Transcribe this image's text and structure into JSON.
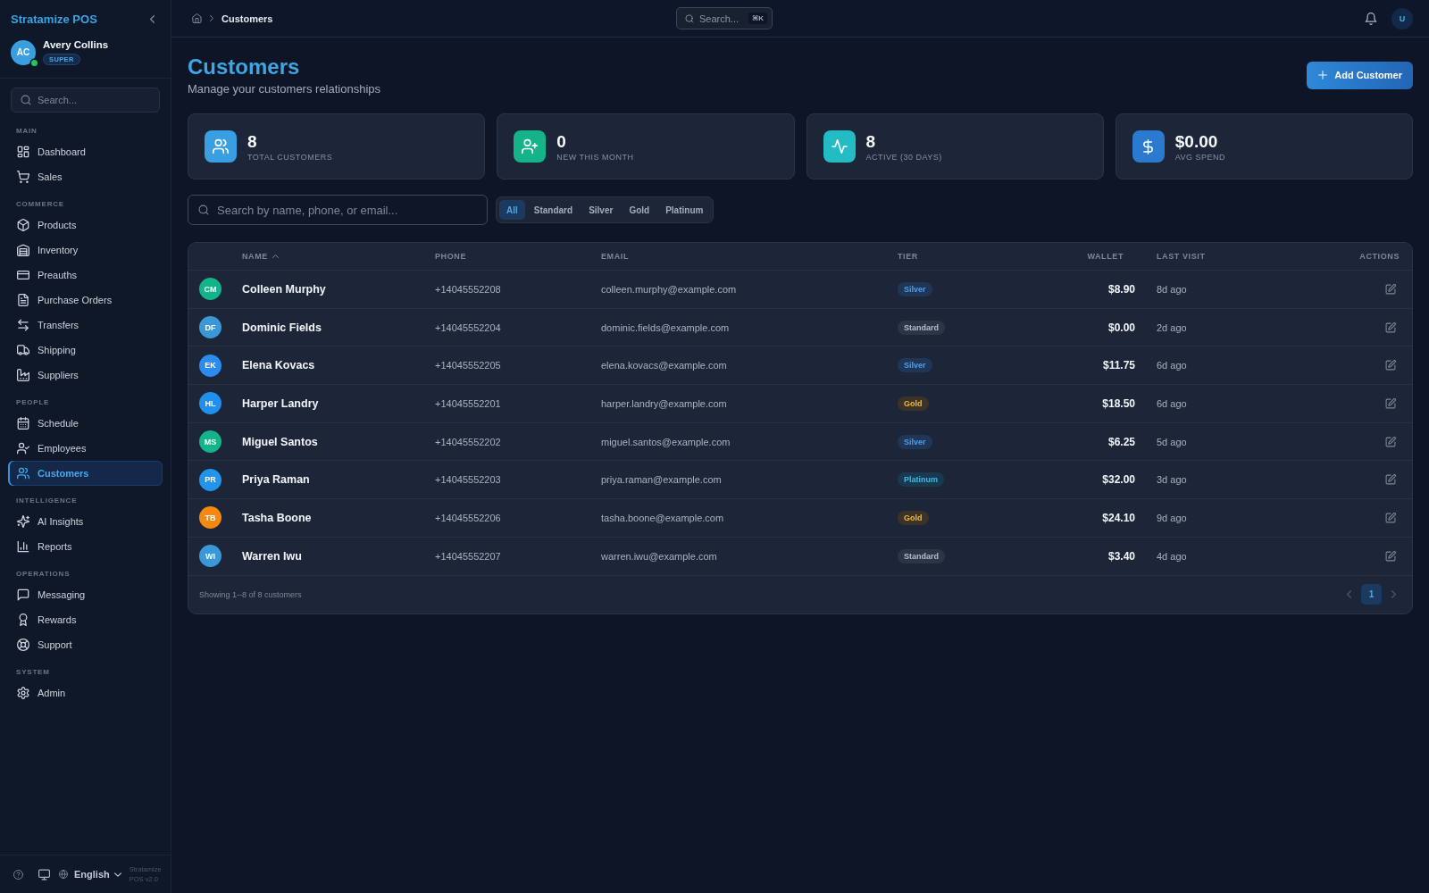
{
  "sidebar": {
    "brand": "Stratamize POS",
    "user": {
      "initials": "AC",
      "name": "Avery Collins",
      "role": "SUPER",
      "online": true
    },
    "search": {
      "placeholder": "Search..."
    },
    "sections": [
      {
        "title": "MAIN",
        "items": [
          {
            "label": "Dashboard",
            "selected": false
          },
          {
            "label": "Sales",
            "selected": false
          }
        ]
      },
      {
        "title": "COMMERCE",
        "items": [
          {
            "label": "Products",
            "selected": false
          },
          {
            "label": "Inventory",
            "selected": false
          },
          {
            "label": "Preauths",
            "selected": false
          },
          {
            "label": "Purchase Orders",
            "selected": false
          },
          {
            "label": "Transfers",
            "selected": false
          },
          {
            "label": "Shipping",
            "selected": false
          },
          {
            "label": "Suppliers",
            "selected": false
          }
        ]
      },
      {
        "title": "PEOPLE",
        "items": [
          {
            "label": "Schedule",
            "selected": false
          },
          {
            "label": "Employees",
            "selected": false
          },
          {
            "label": "Customers",
            "selected": true
          }
        ]
      },
      {
        "title": "INTELLIGENCE",
        "items": [
          {
            "label": "AI Insights",
            "selected": false
          },
          {
            "label": "Reports",
            "selected": false
          }
        ]
      },
      {
        "title": "OPERATIONS",
        "items": [
          {
            "label": "Messaging",
            "selected": false
          },
          {
            "label": "Rewards",
            "selected": false
          },
          {
            "label": "Support",
            "selected": false
          }
        ]
      },
      {
        "title": "SYSTEM",
        "items": [
          {
            "label": "Admin",
            "selected": false
          }
        ]
      }
    ],
    "footer": {
      "language": "English",
      "version": "Stratamize POS v2.0"
    }
  },
  "topbar": {
    "breadcrumb": [
      "Customers"
    ],
    "search": {
      "label": "Search...",
      "shortcut": "⌘K"
    },
    "user_initials": "U"
  },
  "header": {
    "title": "Customers",
    "subtitle": "Manage your customers relationships",
    "add_button": "Add Customer"
  },
  "stats": [
    {
      "value": "8",
      "label": "TOTAL CUSTOMERS",
      "color": "#3a9fe2"
    },
    {
      "value": "0",
      "label": "NEW THIS MONTH",
      "color": "#14b38a"
    },
    {
      "value": "8",
      "label": "ACTIVE (30 DAYS)",
      "color": "#24bcc4"
    },
    {
      "value": "$0.00",
      "label": "AVG SPEND",
      "color": "#2b7ad0"
    }
  ],
  "filters": {
    "search_placeholder": "Search by name, phone, or email...",
    "tiers": [
      {
        "label": "All",
        "selected": true
      },
      {
        "label": "Standard",
        "selected": false
      },
      {
        "label": "Silver",
        "selected": false
      },
      {
        "label": "Gold",
        "selected": false
      },
      {
        "label": "Platinum",
        "selected": false
      }
    ]
  },
  "table": {
    "columns": [
      {
        "label": "NAME",
        "sorted": true
      },
      {
        "label": "PHONE",
        "sorted": false
      },
      {
        "label": "EMAIL",
        "sorted": false
      },
      {
        "label": "TIER",
        "sorted": false
      },
      {
        "label": "WALLET",
        "sorted": false
      },
      {
        "label": "LAST VISIT",
        "sorted": false
      },
      {
        "label": "ACTIONS",
        "sorted": false
      }
    ],
    "rows": [
      {
        "avatar": {
          "initials": "CM",
          "color": "#14b38a"
        },
        "name": "Colleen Murphy",
        "phone": "+14045552208",
        "email": "colleen.murphy@example.com",
        "tier": {
          "label": "Silver",
          "kind": "silver"
        },
        "wallet": "$8.90",
        "last_visit": "8d ago"
      },
      {
        "avatar": {
          "initials": "DF",
          "color": "#3a98d8"
        },
        "name": "Dominic Fields",
        "phone": "+14045552204",
        "email": "dominic.fields@example.com",
        "tier": {
          "label": "Standard",
          "kind": "standard"
        },
        "wallet": "$0.00",
        "last_visit": "2d ago"
      },
      {
        "avatar": {
          "initials": "EK",
          "color": "#2b8cef"
        },
        "name": "Elena Kovacs",
        "phone": "+14045552205",
        "email": "elena.kovacs@example.com",
        "tier": {
          "label": "Silver",
          "kind": "silver"
        },
        "wallet": "$11.75",
        "last_visit": "6d ago"
      },
      {
        "avatar": {
          "initials": "HL",
          "color": "#2090ee"
        },
        "name": "Harper Landry",
        "phone": "+14045552201",
        "email": "harper.landry@example.com",
        "tier": {
          "label": "Gold",
          "kind": "gold"
        },
        "wallet": "$18.50",
        "last_visit": "6d ago"
      },
      {
        "avatar": {
          "initials": "MS",
          "color": "#14b38a"
        },
        "name": "Miguel Santos",
        "phone": "+14045552202",
        "email": "miguel.santos@example.com",
        "tier": {
          "label": "Silver",
          "kind": "silver"
        },
        "wallet": "$6.25",
        "last_visit": "5d ago"
      },
      {
        "avatar": {
          "initials": "PR",
          "color": "#2394ec"
        },
        "name": "Priya Raman",
        "phone": "+14045552203",
        "email": "priya.raman@example.com",
        "tier": {
          "label": "Platinum",
          "kind": "platinum"
        },
        "wallet": "$32.00",
        "last_visit": "3d ago"
      },
      {
        "avatar": {
          "initials": "TB",
          "color": "#f5890f"
        },
        "name": "Tasha Boone",
        "phone": "+14045552206",
        "email": "tasha.boone@example.com",
        "tier": {
          "label": "Gold",
          "kind": "gold"
        },
        "wallet": "$24.10",
        "last_visit": "9d ago"
      },
      {
        "avatar": {
          "initials": "WI",
          "color": "#3a98d8"
        },
        "name": "Warren Iwu",
        "phone": "+14045552207",
        "email": "warren.iwu@example.com",
        "tier": {
          "label": "Standard",
          "kind": "standard"
        },
        "wallet": "$3.40",
        "last_visit": "4d ago"
      }
    ],
    "summary": "Showing 1--8 of 8 customers",
    "pagination": {
      "previous": {
        "disabled": true
      },
      "pages": [
        {
          "label": "1",
          "selected": true
        }
      ],
      "next": {
        "disabled": true
      }
    }
  }
}
